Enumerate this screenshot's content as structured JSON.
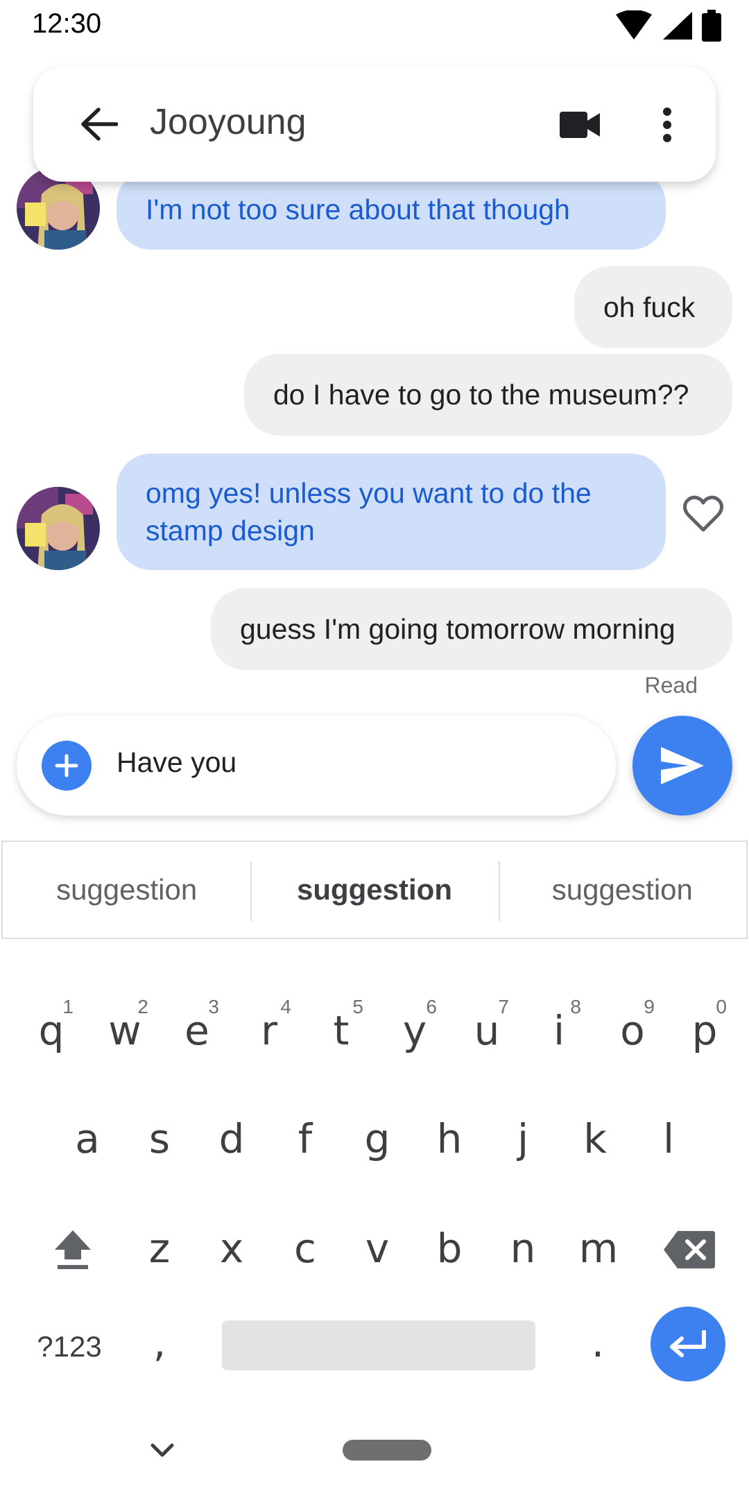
{
  "status_bar": {
    "time": "12:30"
  },
  "header": {
    "contact_name": "Jooyoung"
  },
  "messages": [
    {
      "direction": "incoming",
      "text": "I'm not too sure about that though"
    },
    {
      "direction": "outgoing",
      "text": "oh fuck"
    },
    {
      "direction": "outgoing",
      "text": "do I have to go to the museum??"
    },
    {
      "direction": "incoming",
      "text": "omg yes! unless you want to do the stamp design",
      "reaction_icon": "heart-outline-icon"
    },
    {
      "direction": "outgoing",
      "text": "guess I'm going tomorrow morning"
    }
  ],
  "read_receipt": "Read",
  "compose": {
    "text": "Have you"
  },
  "suggestions": [
    "suggestion",
    "suggestion",
    "suggestion"
  ],
  "keyboard": {
    "row1": [
      {
        "key": "q",
        "hint": "1"
      },
      {
        "key": "w",
        "hint": "2"
      },
      {
        "key": "e",
        "hint": "3"
      },
      {
        "key": "r",
        "hint": "4"
      },
      {
        "key": "t",
        "hint": "5"
      },
      {
        "key": "y",
        "hint": "6"
      },
      {
        "key": "u",
        "hint": "7"
      },
      {
        "key": "i",
        "hint": "8"
      },
      {
        "key": "o",
        "hint": "9"
      },
      {
        "key": "p",
        "hint": "0"
      }
    ],
    "row2": [
      "a",
      "s",
      "d",
      "f",
      "g",
      "h",
      "j",
      "k",
      "l"
    ],
    "row3": [
      "z",
      "x",
      "c",
      "v",
      "b",
      "n",
      "m"
    ],
    "symbols_label": "?123",
    "comma": ",",
    "period": "."
  },
  "colors": {
    "accent": "#3d80f0",
    "incoming_bubble": "#cfdff9",
    "incoming_text": "#1a5bd0",
    "outgoing_bubble": "#efefef"
  }
}
